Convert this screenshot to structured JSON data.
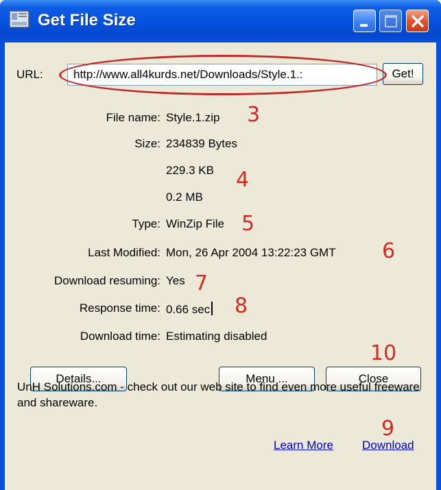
{
  "window": {
    "title": "Get File Size",
    "colors": {
      "titlebar": "#0553de",
      "client": "#ece9d8",
      "annotation": "#d42a1d",
      "link": "#0000cc"
    }
  },
  "url": {
    "label": "URL:",
    "value": "http://www.all4kurds.net/Downloads/Style.1.:",
    "get_label": "Get!"
  },
  "fields": {
    "file_name": {
      "label": "File name:",
      "value": "Style.1.zip"
    },
    "size": {
      "label": "Size:",
      "bytes": "234839 Bytes",
      "kb": "229.3 KB",
      "mb": "0.2 MB"
    },
    "type": {
      "label": "Type:",
      "value": "WinZip File"
    },
    "last_modified": {
      "label": "Last Modified:",
      "value": "Mon, 26 Apr 2004 13:22:23 GMT"
    },
    "download_resuming": {
      "label": "Download resuming:",
      "value": "Yes"
    },
    "response_time": {
      "label": "Response time:",
      "value": "0.66 sec"
    },
    "download_time": {
      "label": "Download time:",
      "value": "Estimating disabled"
    }
  },
  "buttons": {
    "details": "Details...",
    "menu": "Menu ...",
    "close": "Close"
  },
  "footer": {
    "promo": "UnH Solutions.com - check out our web site to find even more useful freeware and shareware.",
    "learn_more": "Learn More",
    "download": "Download"
  },
  "annotations": {
    "n3": "3",
    "n4": "4",
    "n5": "5",
    "n6": "6",
    "n7": "7",
    "n8": "8",
    "n9": "9",
    "n10": "10"
  }
}
